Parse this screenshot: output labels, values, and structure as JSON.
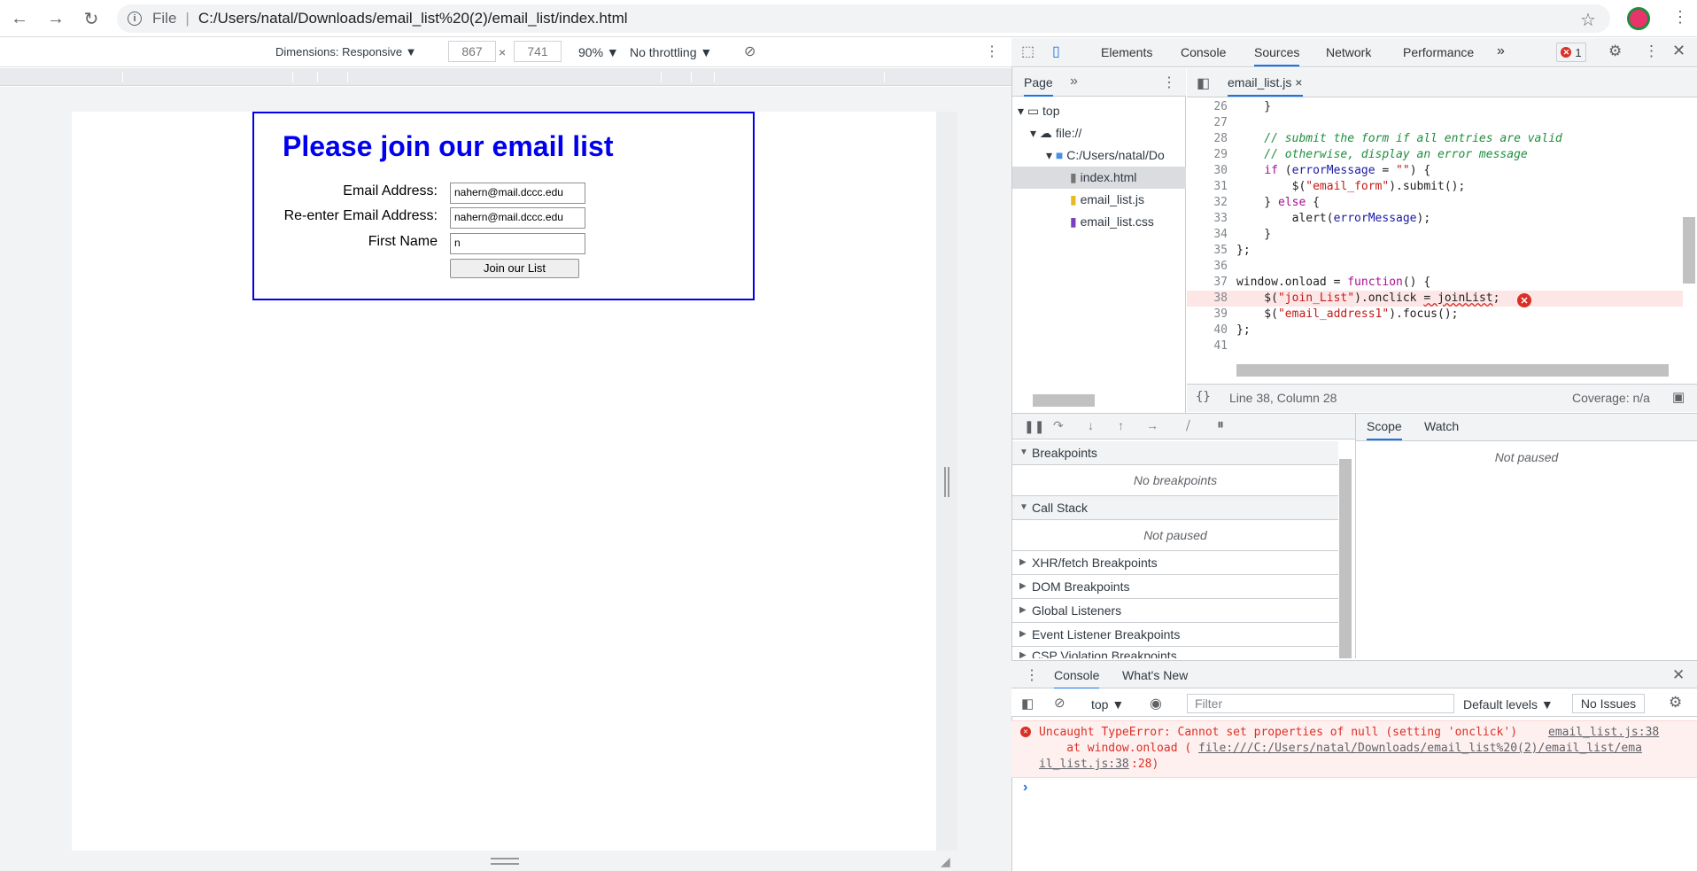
{
  "browser": {
    "url_scheme": "File",
    "url": "C:/Users/natal/Downloads/email_list%20(2)/email_list/index.html"
  },
  "device_toolbar": {
    "dimensions_label": "Dimensions: Responsive ▼",
    "width": "867",
    "times": "×",
    "height": "741",
    "zoom": "90% ▼",
    "throttling": "No throttling ▼"
  },
  "page": {
    "title": "Please join our email list",
    "email_label": "Email Address:",
    "email_value": "nahern@mail.dccc.edu",
    "reemail_label": "Re-enter Email Address:",
    "reemail_value": "nahern@mail.dccc.edu",
    "firstname_label": "First Name",
    "firstname_value": "n",
    "join_button": "Join our List"
  },
  "devtools": {
    "tabs": [
      "Elements",
      "Console",
      "Sources",
      "Network",
      "Performance"
    ],
    "more": "»",
    "error_count": "1",
    "navigator": {
      "tab": "Page",
      "more": "»",
      "tree": {
        "top": "top",
        "file": "file://",
        "folder": "C:/Users/natal/Do",
        "files": [
          "index.html",
          "email_list.js",
          "email_list.css"
        ]
      }
    },
    "editor": {
      "open_tab": "email_list.js",
      "close": "×",
      "line_numbers": [
        "26",
        "27",
        "28",
        "29",
        "30",
        "31",
        "32",
        "33",
        "34",
        "35",
        "36",
        "37",
        "38",
        "39",
        "40",
        "41"
      ],
      "status_position": "Line 38, Column 28",
      "coverage": "Coverage: n/a",
      "pretty": "{}"
    },
    "debugger": {
      "sections": [
        "Breakpoints",
        "Call Stack",
        "XHR/fetch Breakpoints",
        "DOM Breakpoints",
        "Global Listeners",
        "Event Listener Breakpoints",
        "CSP Violation Breakpoints"
      ],
      "no_breakpoints": "No breakpoints",
      "not_paused": "Not paused",
      "scope_tab": "Scope",
      "watch_tab": "Watch",
      "scope_not_paused": "Not paused"
    },
    "drawer": {
      "console_tab": "Console",
      "whats_new_tab": "What's New",
      "context": "top ▼",
      "filter_placeholder": "Filter",
      "levels": "Default levels ▼",
      "issues": "No Issues",
      "error_line1": "Uncaught TypeError: Cannot set properties of null (setting 'onclick')",
      "error_link1": "email_list.js:38",
      "error_line2_prefix": "    at window.onload (",
      "error_link2": "file:///C:/Users/natal/Downloads/email_list%20(2)/email_list/ema",
      "error_line3_link": "il_list.js:38",
      "error_line3_suffix": ":28)",
      "prompt": "›"
    }
  }
}
